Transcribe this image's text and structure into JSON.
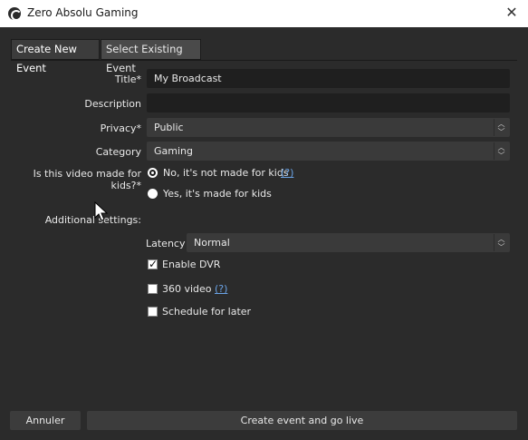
{
  "window": {
    "title": "Zero Absolu Gaming",
    "app_icon": "obs-icon",
    "close_icon": "close-icon"
  },
  "tabs": [
    {
      "label": "Create New Event",
      "active": true
    },
    {
      "label": "Select Existing Event",
      "active": false
    }
  ],
  "form": {
    "title_label": "Title*",
    "title_value": "My Broadcast",
    "description_label": "Description",
    "description_value": "",
    "privacy_label": "Privacy*",
    "privacy_value": "Public",
    "category_label": "Category",
    "category_value": "Gaming",
    "kids_label": "Is this video made for kids?*",
    "kids_options": [
      {
        "label": "No, it's not made for kids",
        "checked": true
      },
      {
        "label": "Yes, it's made for kids",
        "checked": false
      }
    ],
    "help_link": "(?)",
    "additional_label": "Additional settings:",
    "latency_label": "Latency",
    "latency_value": "Normal",
    "enable_dvr_label": "Enable DVR",
    "enable_dvr_checked": true,
    "video360_label": "360 video",
    "video360_checked": false,
    "schedule_label": "Schedule for later",
    "schedule_checked": false
  },
  "footer": {
    "cancel_label": "Annuler",
    "create_label": "Create event and go live"
  }
}
